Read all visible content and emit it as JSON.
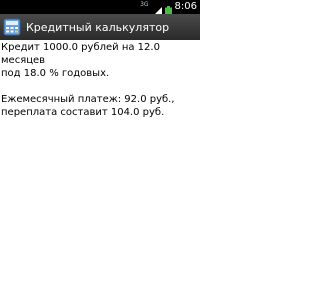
{
  "status_bar": {
    "network_label": "3G",
    "time": "8:06"
  },
  "app": {
    "title": "Кредитный калькулятор",
    "icon": "calculator-icon"
  },
  "result": {
    "line1": "Кредит 1000.0 рублей на 12.0 месяцев",
    "line2": "под 18.0 % годовых.",
    "line3": "Ежемесячный платеж: 92.0 руб.,",
    "line4": "переплата составит 104.0 руб."
  },
  "colors": {
    "status_bar": "#000000",
    "title_bar": "#3a3a3a",
    "battery": "#44c044",
    "signal": "#ffffff"
  }
}
